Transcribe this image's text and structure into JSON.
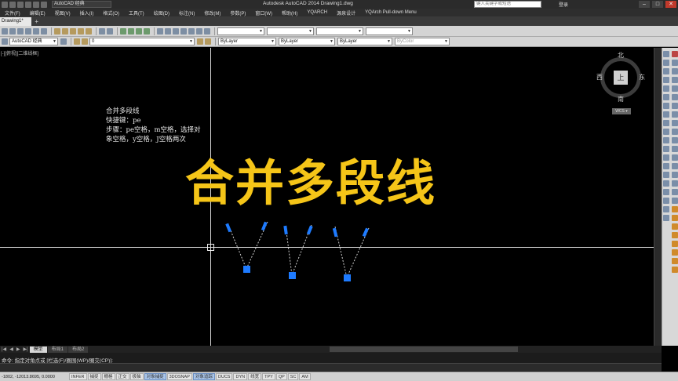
{
  "window": {
    "title": "Autodesk AutoCAD 2014    Drawing1.dwg",
    "workspace": "AutoCAD 经典",
    "search_placeholder": "键入关键字或短语",
    "login": "登录",
    "minimize": "–",
    "maximize": "□",
    "close": "✕"
  },
  "menu": [
    "文件(F)",
    "编辑(E)",
    "视图(V)",
    "插入(I)",
    "格式(O)",
    "工具(T)",
    "绘图(D)",
    "标注(N)",
    "修改(M)",
    "参数(P)",
    "窗口(W)",
    "帮助(H)",
    "YQARCH",
    "源泉设计",
    "YQArch Pull-down Menu"
  ],
  "doc_tab": {
    "label": "Drawing1*",
    "add": "+"
  },
  "toolbar": {
    "workspace_combo": "AutoCAD 经典",
    "layer_combo": "0",
    "color_combo": "ByLayer",
    "linetype_combo": "ByLayer",
    "lineweight_combo": "ByLayer",
    "plotstyle_combo": "ByColor"
  },
  "canvas": {
    "viewport_label": "[-][俯视][二维线框]",
    "note_lines": [
      "合并多段线",
      "快捷键：pe",
      "步骤：pe空格，m空格，选择对",
      "象空格，y空格，J空格两次"
    ],
    "big_title": "合并多段线",
    "accent_color": "#f5c518",
    "grip_color": "#1e7bff"
  },
  "viewcube": {
    "north": "北",
    "south": "南",
    "east": "东",
    "west": "西",
    "face": "上",
    "wcs": "WCS ▾"
  },
  "layout_tabs": [
    "模型",
    "布局1",
    "布局2"
  ],
  "command": {
    "history": "命令: 指定对角点或 [栏选(F)/圈围(WP)/圈交(CP)]:",
    "input": ""
  },
  "status": {
    "coords": "-1802, -12013.8695, 0.0000",
    "buttons": [
      {
        "label": "INFER",
        "on": false
      },
      {
        "label": "捕捉",
        "on": false
      },
      {
        "label": "栅格",
        "on": false
      },
      {
        "label": "正交",
        "on": false
      },
      {
        "label": "极轴",
        "on": false
      },
      {
        "label": "对象捕捉",
        "on": true
      },
      {
        "label": "3DOSNAP",
        "on": false
      },
      {
        "label": "对象追踪",
        "on": true
      },
      {
        "label": "DUCS",
        "on": false
      },
      {
        "label": "DYN",
        "on": false
      },
      {
        "label": "线宽",
        "on": false
      },
      {
        "label": "TPY",
        "on": false
      },
      {
        "label": "QP",
        "on": false
      },
      {
        "label": "SC",
        "on": false
      },
      {
        "label": "AM",
        "on": false
      }
    ]
  }
}
